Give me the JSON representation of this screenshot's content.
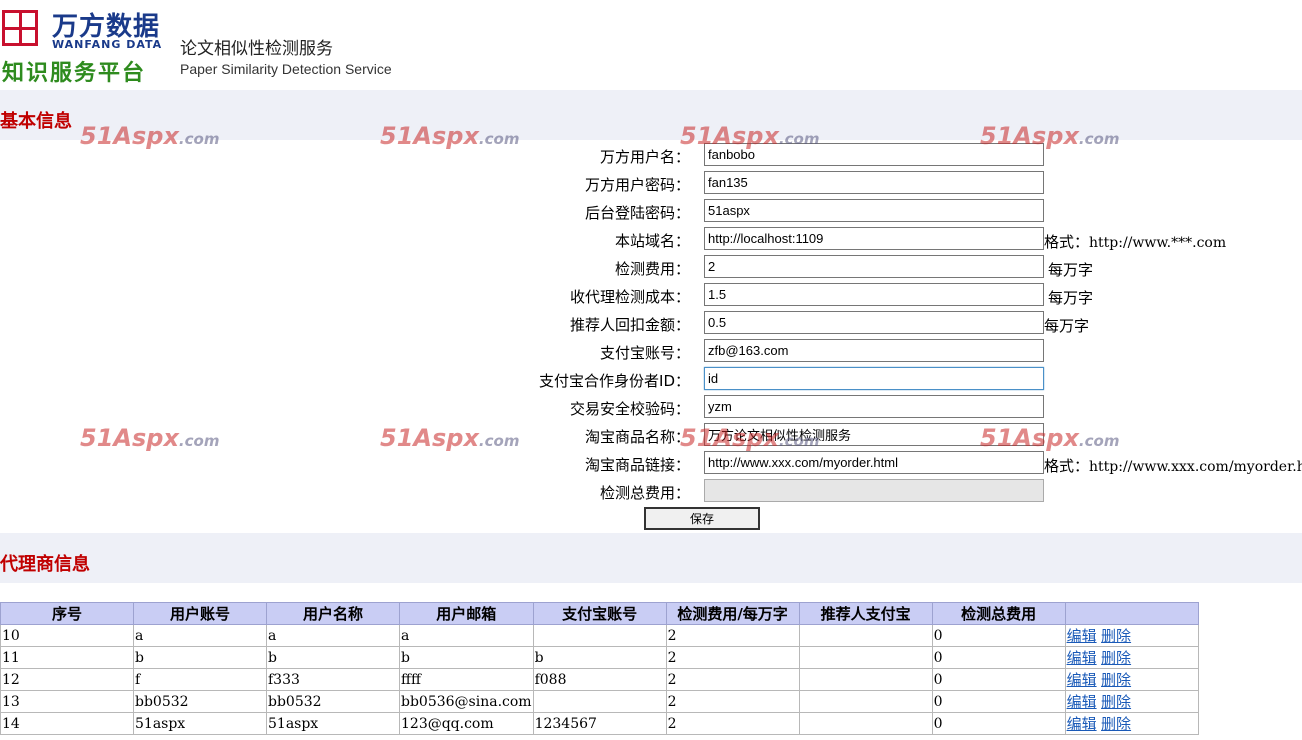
{
  "header": {
    "brand_cn": "万方数据",
    "brand_en": "WANFANG DATA",
    "platform_cn": "知识服务平台",
    "service_cn": "论文相似性检测服务",
    "service_en": "Paper Similarity Detection Service"
  },
  "watermark": {
    "text": "51Aspx",
    "suffix": ".com"
  },
  "basic": {
    "title": "基本信息",
    "fields": [
      {
        "label": "万方用户名：",
        "value": "fanbobo",
        "suffix": ""
      },
      {
        "label": "万方用户密码：",
        "value": "fan135",
        "suffix": ""
      },
      {
        "label": "后台登陆密码：",
        "value": "51aspx",
        "suffix": ""
      },
      {
        "label": "本站域名：",
        "value": "http://localhost:1109",
        "suffix": "格式：",
        "suffix_ex": "http://www.***.com"
      },
      {
        "label": "检测费用：",
        "value": "2",
        "suffix": "每万字"
      },
      {
        "label": "收代理检测成本：",
        "value": "1.5",
        "suffix": "每万字"
      },
      {
        "label": "推荐人回扣金额：",
        "value": "0.5",
        "suffix": "每万字"
      },
      {
        "label": "支付宝账号：",
        "value": "zfb@163.com",
        "suffix": ""
      },
      {
        "label": "支付宝合作身份者ID：",
        "value": "id",
        "suffix": ""
      },
      {
        "label": "交易安全校验码：",
        "value": "yzm",
        "suffix": ""
      },
      {
        "label": "淘宝商品名称：",
        "value": "万方论文相似性检测服务",
        "suffix": ""
      },
      {
        "label": "淘宝商品链接：",
        "value": "http://www.xxx.com/myorder.html",
        "suffix": "格式：",
        "suffix_ex": "http://www.xxx.com/myorder.html"
      },
      {
        "label": "检测总费用：",
        "value": "",
        "suffix": ""
      }
    ],
    "save_label": "保存"
  },
  "agents": {
    "title": "代理商信息",
    "headers": [
      "序号",
      "用户账号",
      "用户名称",
      "用户邮箱",
      "支付宝账号",
      "检测费用/每万字",
      "推荐人支付宝",
      "检测总费用",
      ""
    ],
    "edit_label": "编辑",
    "delete_label": "删除",
    "rows": [
      [
        "10",
        "a",
        "a",
        "a",
        "",
        "2",
        "",
        "0"
      ],
      [
        "11",
        "b",
        "b",
        "b",
        "b",
        "2",
        "",
        "0"
      ],
      [
        "12",
        "f",
        "f333",
        "ffff",
        "f088",
        "2",
        "",
        "0"
      ],
      [
        "13",
        "bb0532",
        "bb0532",
        "bb0536@sina.com",
        "",
        "2",
        "",
        "0"
      ],
      [
        "14",
        "51aspx",
        "51aspx",
        "123@qq.com",
        "1234567",
        "2",
        "",
        "0"
      ]
    ]
  }
}
